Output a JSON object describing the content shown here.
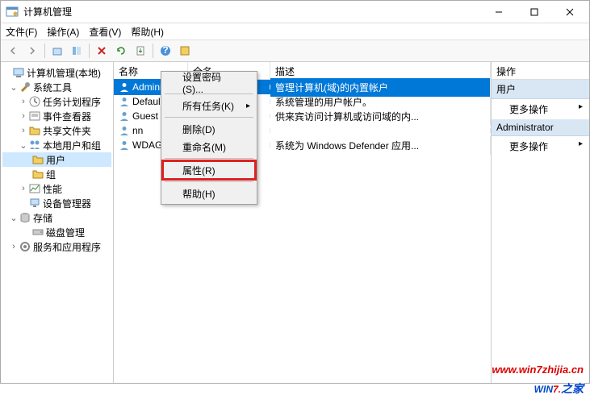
{
  "window": {
    "title": "计算机管理"
  },
  "winbtns": {
    "min": "—",
    "max": "☐",
    "close": "✕"
  },
  "menubar": [
    "文件(F)",
    "操作(A)",
    "查看(V)",
    "帮助(H)"
  ],
  "tree": {
    "root": "计算机管理(本地)",
    "sys": "系统工具",
    "task": "任务计划程序",
    "event": "事件查看器",
    "shared": "共享文件夹",
    "localug": "本地用户和组",
    "users": "用户",
    "groups": "组",
    "perf": "性能",
    "devmgr": "设备管理器",
    "storage": "存储",
    "disk": "磁盘管理",
    "svc": "服务和应用程序"
  },
  "columns": {
    "name": "名称",
    "full": "全名",
    "desc": "描述"
  },
  "rows": [
    {
      "name": "Administrator",
      "full": "",
      "desc": "管理计算机(域)的内置帐户",
      "selected": true
    },
    {
      "name": "DefaultAcc...",
      "full": "",
      "desc": "系统管理的用户帐户。"
    },
    {
      "name": "Guest",
      "full": "",
      "desc": "供来宾访问计算机或访问域的内..."
    },
    {
      "name": "nn",
      "full": "",
      "desc": ""
    },
    {
      "name": "WDAGUtility...",
      "full": "",
      "desc": "系统为 Windows Defender 应用..."
    }
  ],
  "ctx": {
    "setpwd": "设置密码(S)...",
    "alltasks": "所有任务(K)",
    "delete": "删除(D)",
    "rename": "重命名(M)",
    "props": "属性(R)",
    "help": "帮助(H)"
  },
  "actions": {
    "header": "操作",
    "group1": "用户",
    "more1": "更多操作",
    "group2": "Administrator",
    "more2": "更多操作"
  },
  "watermark": {
    "url": "www.win7zhijia.cn",
    "logo_w": "W",
    "logo_in": "IN",
    "logo_7": "7.",
    "logo_end": "家"
  }
}
